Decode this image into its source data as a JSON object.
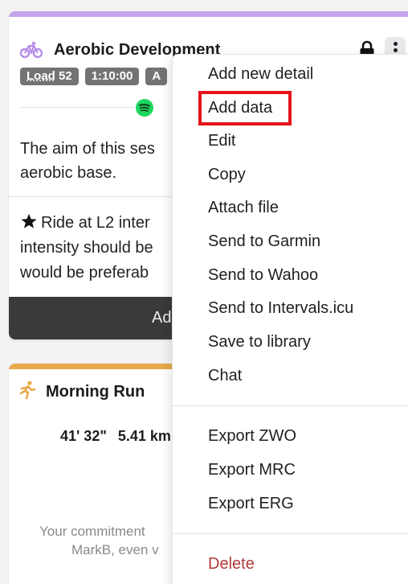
{
  "card1": {
    "title": "Aerobic Development",
    "accent_color": "#c3a4ec",
    "badges": [
      {
        "prefix": "Load",
        "value": "52"
      },
      {
        "value": "1:10:00"
      },
      {
        "value": "A"
      }
    ],
    "description": "The aim of this ses aerobic base.",
    "description_lines": [
      "The aim of this ses",
      "aerobic base."
    ],
    "instruction_lines": [
      "Ride at L2 inter",
      "intensity should be",
      "would be preferab"
    ],
    "add_bar_label": "Ad"
  },
  "card2": {
    "title": "Morning Run",
    "accent_color": "#e8a94b",
    "duration": "41' 32\"",
    "distance": "5.41 km",
    "note_lines": [
      "Your commitment",
      "MarkB, even v"
    ]
  },
  "menu": {
    "group1": [
      "Add new detail",
      "Add data",
      "Edit",
      "Copy",
      "Attach file",
      "Send to Garmin",
      "Send to Wahoo",
      "Send to Intervals.icu",
      "Save to library",
      "Chat"
    ],
    "group2": [
      "Export ZWO",
      "Export MRC",
      "Export ERG"
    ],
    "danger": "Delete",
    "danger_color": "#b23a3a",
    "highlighted_item": "Add data",
    "highlight_color": "#e5131a"
  },
  "icons": {
    "card1_type": "bike-icon",
    "card2_type": "run-icon",
    "lock": "lock-icon",
    "more": "kebab-menu-icon",
    "music": "spotify-icon",
    "star": "star-icon"
  }
}
